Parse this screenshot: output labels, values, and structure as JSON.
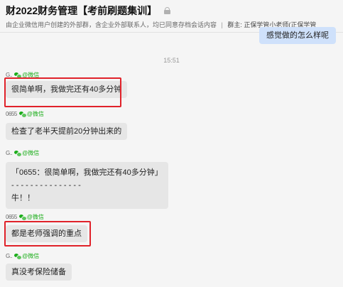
{
  "header": {
    "title": "财2022财务管理【考前刷题集训】",
    "notice": "由企业微信用户创建的外部群，含企业外部联系人，均已同意存档会话内容",
    "owner": "群主: 正保学管小老师(正保学管"
  },
  "own_message": {
    "text": "感觉做的怎么样呢"
  },
  "timestamp": "15:51",
  "messages": [
    {
      "name": "G..",
      "source": "@微信",
      "text": "很简单啊，我做完还有40多分钟",
      "highlighted": true
    },
    {
      "name": "0655",
      "source": "@微信",
      "text": "检查了老半天提前20分钟出来的",
      "highlighted": false
    },
    {
      "name": "G..",
      "source": "@微信",
      "quote_line1": "「0655：很简单啊，我做完还有40多分钟」",
      "quote_line2": "- - - - - - - - - - - - - - -",
      "quote_reply": "牛！！",
      "highlighted": false
    },
    {
      "name": "0655",
      "source": "@微信",
      "text": "都是老师强调的重点",
      "highlighted": true
    },
    {
      "name": "G..",
      "source": "@微信",
      "text": "真没考保险储备",
      "highlighted": false
    }
  ],
  "colors": {
    "highlight_border": "#e0222a",
    "wechat_green": "#1aad19",
    "bubble_gray": "#e6e6e6",
    "own_bubble": "#cfe1fb"
  }
}
